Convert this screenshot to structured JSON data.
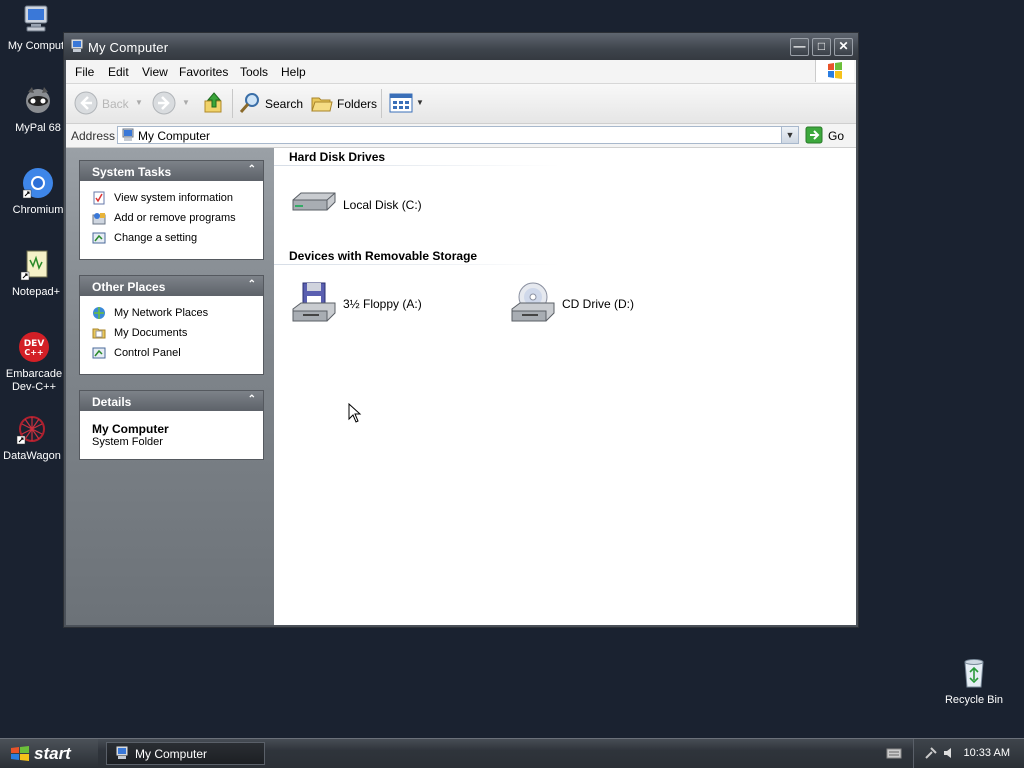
{
  "desktop": {
    "icons": [
      {
        "label": "My Comput",
        "icon": "computer-icon"
      },
      {
        "label": "MyPal 68",
        "icon": "raccoon-icon"
      },
      {
        "label": "Chromium",
        "icon": "chromium-icon"
      },
      {
        "label": "Notepad+",
        "icon": "notepad-icon"
      },
      {
        "label": "Embarcade",
        "label2": "Dev-C++",
        "icon": "devcpp-icon"
      },
      {
        "label": "DataWagon",
        "icon": "datawagon-icon"
      },
      {
        "label": "Recycle Bin",
        "icon": "recycle-bin-icon"
      }
    ]
  },
  "window": {
    "title": "My Computer",
    "menu": [
      "File",
      "Edit",
      "View",
      "Favorites",
      "Tools",
      "Help"
    ],
    "toolbar": {
      "back": "Back",
      "search": "Search",
      "folders": "Folders"
    },
    "address": {
      "label": "Address",
      "value": "My Computer",
      "go": "Go"
    },
    "left": {
      "system_tasks": {
        "title": "System Tasks",
        "items": [
          "View system information",
          "Add or remove programs",
          "Change a setting"
        ]
      },
      "other_places": {
        "title": "Other Places",
        "items": [
          "My Network Places",
          "My Documents",
          "Control Panel"
        ]
      },
      "details": {
        "title": "Details",
        "name": "My Computer",
        "type": "System Folder"
      }
    },
    "groups": {
      "hdd": {
        "title": "Hard Disk Drives",
        "items": [
          "Local Disk (C:)"
        ]
      },
      "removable": {
        "title": "Devices with Removable Storage",
        "items": [
          "3½ Floppy (A:)",
          "CD Drive (D:)"
        ]
      }
    }
  },
  "taskbar": {
    "start": "start",
    "task": "My Computer",
    "clock": "10:33 AM"
  },
  "colors": {
    "desktop": "#1a2230",
    "accent": "#2a5fbf"
  }
}
